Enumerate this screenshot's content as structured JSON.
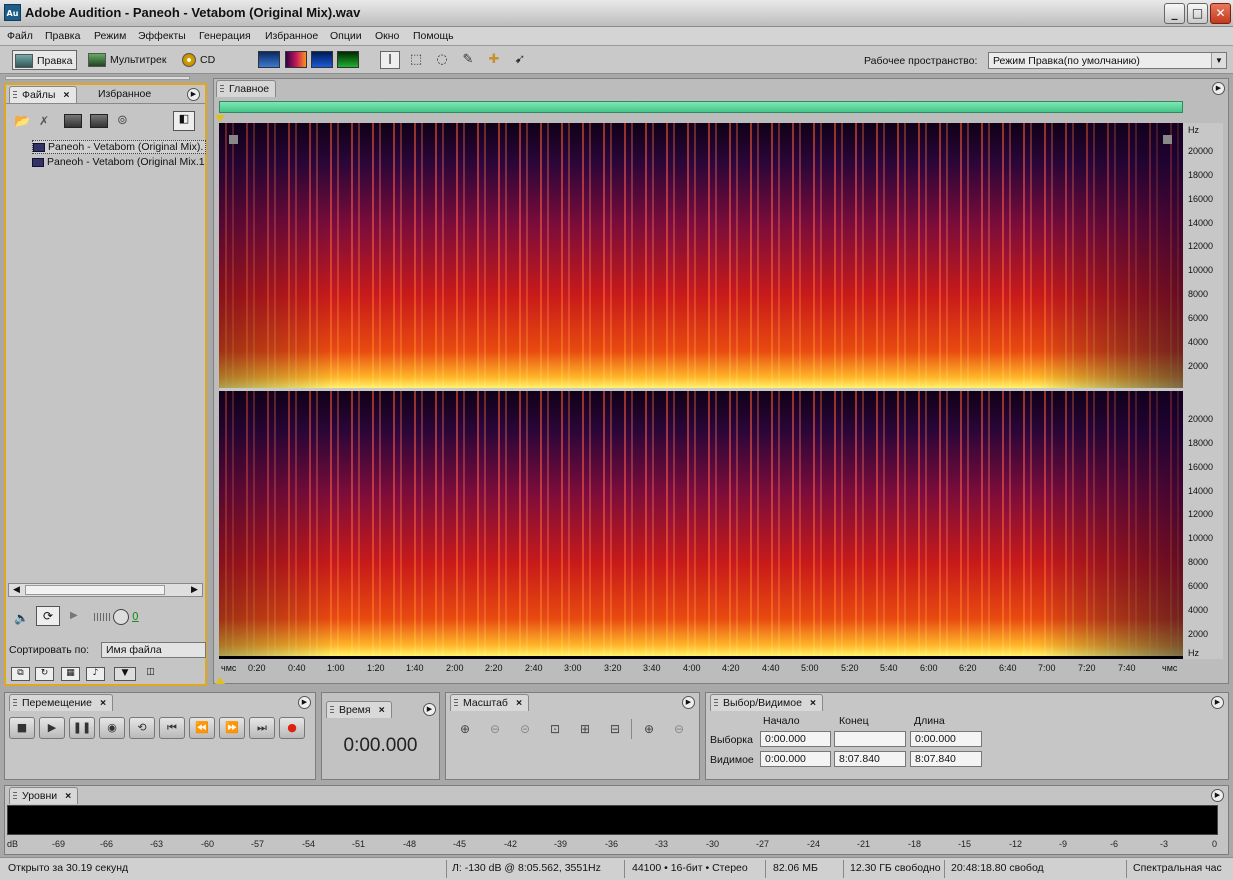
{
  "window": {
    "title": "Adobe Audition - Paneoh - Vetabom (Original Mix).wav",
    "logo": "Au"
  },
  "menu": [
    "Файл",
    "Правка",
    "Режим",
    "Эффекты",
    "Генерация",
    "Избранное",
    "Опции",
    "Окно",
    "Помощь"
  ],
  "toolbar": {
    "edit": "Правка",
    "multitrack": "Мультитрек",
    "cd": "CD",
    "workspace_label": "Рабочее пространство:",
    "workspace_value": "Режим Правка(по умолчанию)"
  },
  "files_panel": {
    "tab_files": "Файлы",
    "tab_favorites": "Избранное",
    "files": [
      "Paneoh - Vetabom (Original Mix).",
      "Paneoh - Vetabom (Original Mix.1"
    ],
    "volume_value": "0",
    "sort_label": "Сортировать по:",
    "sort_value": "Имя файла"
  },
  "main_panel": {
    "tab": "Главное",
    "hz_top": [
      "Hz",
      "20000",
      "18000",
      "16000",
      "14000",
      "12000",
      "10000",
      "8000",
      "6000",
      "4000",
      "2000"
    ],
    "hz_bottom": [
      "20000",
      "18000",
      "16000",
      "14000",
      "12000",
      "10000",
      "8000",
      "6000",
      "4000",
      "2000",
      "Hz"
    ],
    "timeline": [
      "чмс",
      "0:20",
      "0:40",
      "1:00",
      "1:20",
      "1:40",
      "2:00",
      "2:20",
      "2:40",
      "3:00",
      "3:20",
      "3:40",
      "4:00",
      "4:20",
      "4:40",
      "5:00",
      "5:20",
      "5:40",
      "6:00",
      "6:20",
      "6:40",
      "7:00",
      "7:20",
      "7:40",
      "чмс"
    ]
  },
  "transport": {
    "tab": "Перемещение"
  },
  "time": {
    "tab": "Время",
    "value": "0:00.000"
  },
  "zoom": {
    "tab": "Масштаб"
  },
  "selection": {
    "tab": "Выбор/Видимое",
    "col_start": "Начало",
    "col_end": "Конец",
    "col_length": "Длина",
    "row_selection": "Выборка",
    "row_visible": "Видимое",
    "sel_start": "0:00.000",
    "sel_end": "",
    "sel_length": "0:00.000",
    "vis_start": "0:00.000",
    "vis_end": "8:07.840",
    "vis_length": "8:07.840"
  },
  "levels": {
    "tab": "Уровни",
    "scale": [
      "dB",
      "-69",
      "-66",
      "-63",
      "-60",
      "-57",
      "-54",
      "-51",
      "-48",
      "-45",
      "-42",
      "-39",
      "-36",
      "-33",
      "-30",
      "-27",
      "-24",
      "-21",
      "-18",
      "-15",
      "-12",
      "-9",
      "-6",
      "-3",
      "0"
    ]
  },
  "status": {
    "opened": "Открыто за 30.19 секунд",
    "cursor": "Л: -130 dB @   8:05.562, 3551Hz",
    "format": "44100 • 16-бит • Стерео",
    "size": "82.06 МБ",
    "free": "12.30 ГБ свободно",
    "time_free": "20:48:18.80 свобод",
    "view": "Спектральная час"
  }
}
